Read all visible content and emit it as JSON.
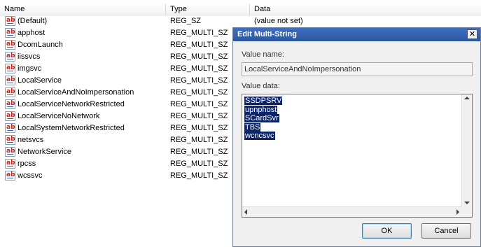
{
  "columns": {
    "name": "Name",
    "type": "Type",
    "data": "Data"
  },
  "icon": {
    "name": "string-value-icon",
    "glyph": "ab"
  },
  "rows": [
    {
      "name": "(Default)",
      "type": "REG_SZ",
      "data": "(value not set)"
    },
    {
      "name": "apphost",
      "type": "REG_MULTI_SZ",
      "data": ""
    },
    {
      "name": "DcomLaunch",
      "type": "REG_MULTI_SZ",
      "data": ""
    },
    {
      "name": "iissvcs",
      "type": "REG_MULTI_SZ",
      "data": ""
    },
    {
      "name": "imgsvc",
      "type": "REG_MULTI_SZ",
      "data": ""
    },
    {
      "name": "LocalService",
      "type": "REG_MULTI_SZ",
      "data": ""
    },
    {
      "name": "LocalServiceAndNoImpersonation",
      "type": "REG_MULTI_SZ",
      "data": ""
    },
    {
      "name": "LocalServiceNetworkRestricted",
      "type": "REG_MULTI_SZ",
      "data": ""
    },
    {
      "name": "LocalServiceNoNetwork",
      "type": "REG_MULTI_SZ",
      "data": ""
    },
    {
      "name": "LocalSystemNetworkRestricted",
      "type": "REG_MULTI_SZ",
      "data": ""
    },
    {
      "name": "netsvcs",
      "type": "REG_MULTI_SZ",
      "data": ""
    },
    {
      "name": "NetworkService",
      "type": "REG_MULTI_SZ",
      "data": ""
    },
    {
      "name": "rpcss",
      "type": "REG_MULTI_SZ",
      "data": ""
    },
    {
      "name": "wcssvc",
      "type": "REG_MULTI_SZ",
      "data": ""
    }
  ],
  "dialog": {
    "title": "Edit Multi-String",
    "close_glyph": "✕",
    "value_name_label": "Value name:",
    "value_name": "LocalServiceAndNoImpersonation",
    "value_data_label": "Value data:",
    "value_data_lines": [
      "SSDPSRV",
      "upnphost",
      "SCardSvr",
      "TBS",
      "wcncsvc"
    ],
    "ok_label": "OK",
    "cancel_label": "Cancel"
  },
  "colors": {
    "selection": "#0c246a",
    "title_bar": "#2b579c",
    "icon_text": "#c0241c"
  }
}
